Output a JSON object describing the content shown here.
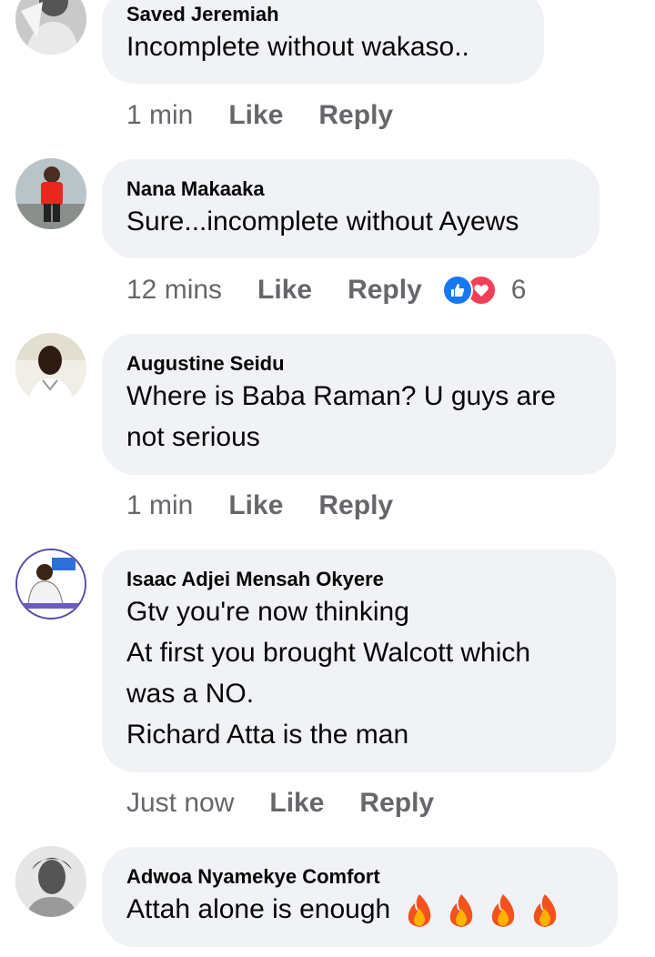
{
  "colors": {
    "bubble_bg": "#f0f2f5",
    "meta_text": "#65676b",
    "like_blue": "#1877f2",
    "love_red": "#f33e58"
  },
  "comments": [
    {
      "author": "Saved Jeremiah",
      "text": "Incomplete without wakaso..",
      "time": "1 min",
      "like": "Like",
      "reply": "Reply"
    },
    {
      "author": "Nana Makaaka",
      "text": "Sure...incomplete without Ayews",
      "time": "12 mins",
      "like": "Like",
      "reply": "Reply",
      "reactions": {
        "icons": [
          "like-reaction-icon",
          "love-reaction-icon"
        ],
        "count": "6"
      }
    },
    {
      "author": "Augustine Seidu",
      "text": "Where is Baba Raman? U guys are not serious",
      "time": "1 min",
      "like": "Like",
      "reply": "Reply"
    },
    {
      "author": "Isaac Adjei Mensah Okyere",
      "text_lines": [
        "Gtv you're now thinking",
        "At first you brought Walcott which",
        "was a NO.",
        "Richard Atta is the man"
      ],
      "time": "Just now",
      "like": "Like",
      "reply": "Reply"
    },
    {
      "author": "Adwoa Nyamekye Comfort",
      "text": "Attah alone is enough",
      "emojis": [
        "fire-emoji",
        "fire-emoji",
        "fire-emoji",
        "fire-emoji"
      ]
    }
  ]
}
